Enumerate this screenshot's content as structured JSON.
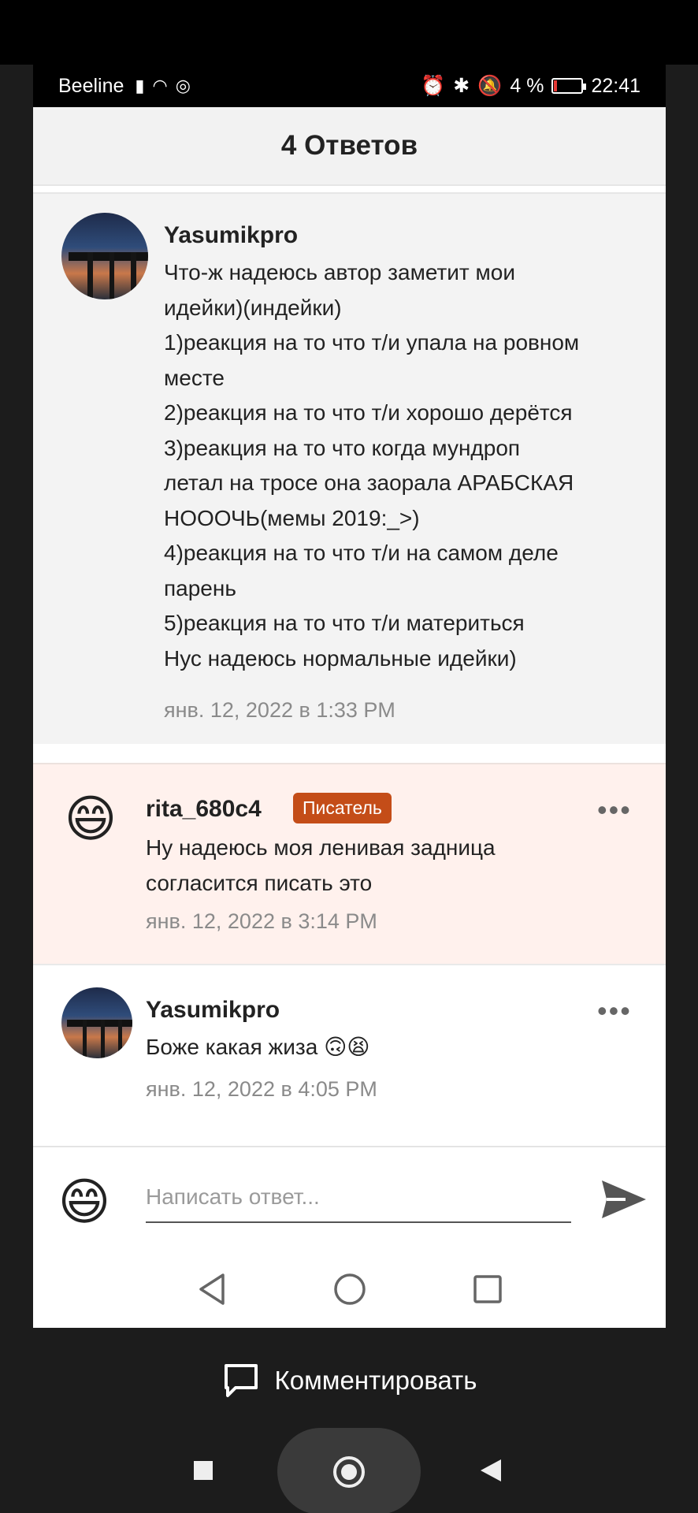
{
  "status_bar": {
    "carrier": "Beeline",
    "battery": "4 %",
    "time": "22:41"
  },
  "header": {
    "title": "4 Ответов"
  },
  "comments": [
    {
      "username": "Yasumikpro",
      "lines": [
        "Что-ж надеюсь автор заметит мои",
        "идейки)(индейки)",
        "1)реакция на то что т/и упала на ровном",
        "месте",
        "2)реакция на то что т/и хорошо дерётся",
        "3)реакция на то что когда мундроп",
        "летал на тросе она заорала АРАБСКАЯ",
        "НОООЧЬ(мемы 2019:_>)",
        "4)реакция на то что т/и на самом деле",
        "парень",
        "5)реакция на то что т/и материться",
        "Нус надеюсь нормальные идейки)"
      ],
      "time": "янв. 12, 2022 в 1:33 PM"
    },
    {
      "username": "rita_680c4",
      "badge": "Писатель",
      "avatar_emoji": "😄",
      "lines": [
        "Ну надеюсь моя ленивая задница",
        "согласится писать это"
      ],
      "time": "янв. 12, 2022 в 3:14 PM",
      "more": "•••"
    },
    {
      "username": "Yasumikpro",
      "lines": [
        "Боже какая жиза 🙃😫"
      ],
      "time": "янв. 12, 2022 в 4:05 PM",
      "more": "•••"
    }
  ],
  "reply": {
    "avatar_emoji": "😄",
    "placeholder": "Написать ответ..."
  },
  "comment_button": {
    "label": "Комментировать"
  },
  "colors": {
    "badge": "#c44d18",
    "highlight_bg": "#fff1ed",
    "first_bg": "#f3f3f3"
  }
}
